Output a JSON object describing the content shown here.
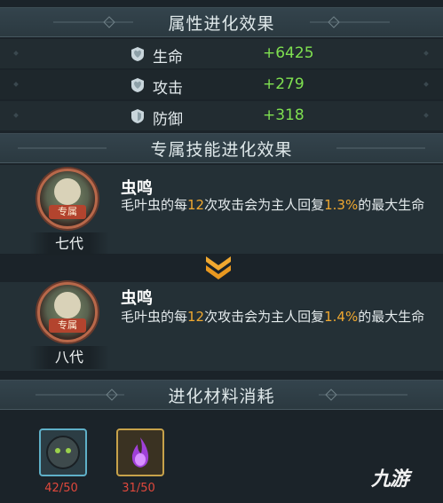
{
  "attr_section": {
    "title": "属性进化效果",
    "rows": [
      {
        "icon": "heart-shield-icon",
        "label": "生命",
        "value": "+6425"
      },
      {
        "icon": "attack-shield-icon",
        "label": "攻击",
        "value": "+279"
      },
      {
        "icon": "defense-shield-icon",
        "label": "防御",
        "value": "+318"
      }
    ]
  },
  "skill_section": {
    "title": "专属技能进化效果",
    "badge_label": "专属",
    "before": {
      "generation": "七代",
      "name": "虫鸣",
      "desc_prefix": "毛叶虫的每",
      "hits": "12",
      "desc_mid": "次攻击会为主人回复",
      "percent": "1.3%",
      "desc_suffix": "的最大生命"
    },
    "after": {
      "generation": "八代",
      "name": "虫鸣",
      "desc_prefix": "毛叶虫的每",
      "hits": "12",
      "desc_mid": "次攻击会为主人回复",
      "percent": "1.4%",
      "desc_suffix": "的最大生命"
    }
  },
  "materials_section": {
    "title": "进化材料消耗",
    "items": [
      {
        "icon": "shadow-beast-icon",
        "count": "42/50"
      },
      {
        "icon": "purple-flame-icon",
        "count": "31/50"
      }
    ]
  },
  "watermark": "九游",
  "colors": {
    "accent": "#f0a830",
    "value_green": "#7fe050",
    "shortfall_red": "#e0483c"
  }
}
